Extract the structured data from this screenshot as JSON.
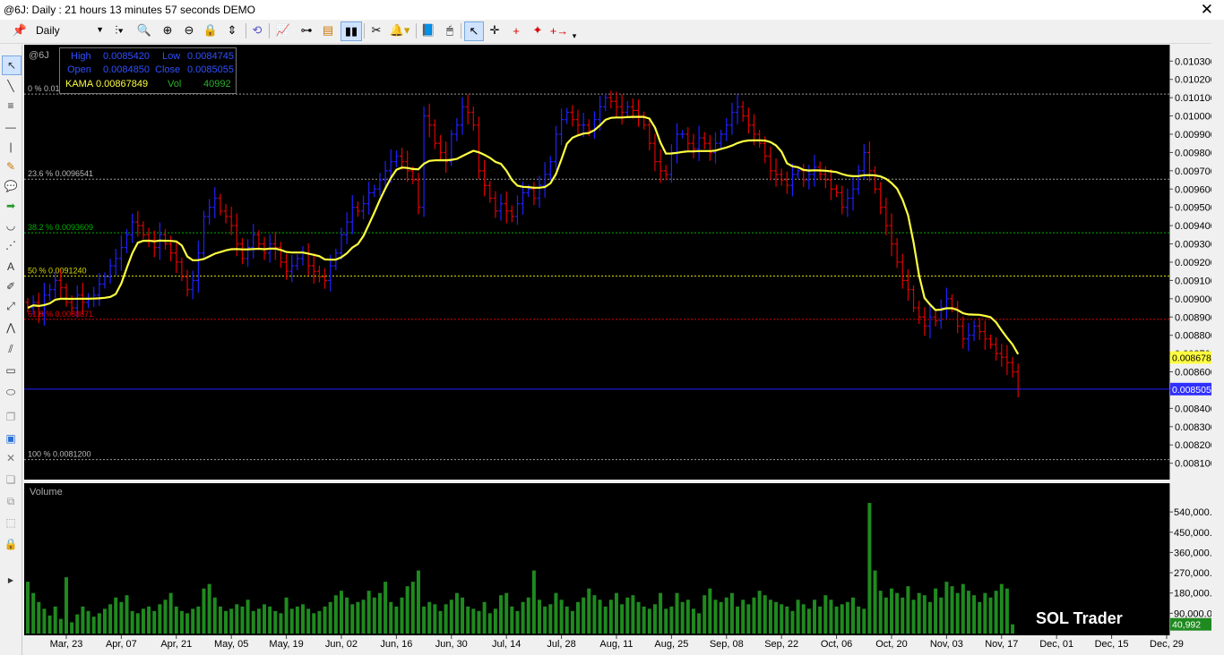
{
  "window": {
    "title": "@6J: Daily : 21 hours 13 minutes 57 seconds DEMO",
    "close": "✕"
  },
  "toolbar": {
    "interval": "Daily"
  },
  "info": {
    "high_label": "High",
    "high": "0.0085420",
    "low_label": "Low",
    "low": "0.0084745",
    "open_label": "Open",
    "open": "0.0084850",
    "close_label": "Close",
    "close": "0.0085055",
    "kama_label": "KAMA",
    "kama": "0.00867849",
    "vol_label": "Vol",
    "vol": "40992"
  },
  "symbol": "@6J",
  "volume_panel": {
    "title": "Volume",
    "last_value": "40,992"
  },
  "watermark": "SOL Trader",
  "chart_data": {
    "type": "ohlc",
    "y_ticks": [
      0.0081,
      0.0082,
      0.0083,
      0.0084,
      0.0085,
      0.0086,
      0.0087,
      0.0088,
      0.0089,
      0.009,
      0.0091,
      0.0092,
      0.0093,
      0.0094,
      0.0095,
      0.0096,
      0.0097,
      0.0098,
      0.0099,
      0.01,
      0.0101,
      0.0102,
      0.0103
    ],
    "y_tick_labels": [
      "0.0081000",
      "0.0082000",
      "0.0083000",
      "0.0084000",
      "0.0085000",
      "0.0086000",
      "0.0087000",
      "0.0088000",
      "0.0089000",
      "0.0090000",
      "0.0091000",
      "0.0092000",
      "0.0093000",
      "0.0094000",
      "0.0095000",
      "0.0096000",
      "0.0097000",
      "0.0098000",
      "0.0099000",
      "0.0100000",
      "0.0101000",
      "0.0102000",
      "0.0103000"
    ],
    "ylim": [
      0.00802,
      0.01037
    ],
    "x_labels": [
      "Mar, 23",
      "Apr, 07",
      "Apr, 21",
      "May, 05",
      "May, 19",
      "Jun, 02",
      "Jun, 16",
      "Jun, 30",
      "Jul, 14",
      "Jul, 28",
      "Aug, 11",
      "Aug, 25",
      "Sep, 08",
      "Sep, 22",
      "Oct, 06",
      "Oct, 20",
      "Nov, 03",
      "Nov, 17",
      "Dec, 01",
      "Dec, 15",
      "Dec, 29"
    ],
    "x_label_index": [
      7,
      17,
      27,
      37,
      47,
      57,
      67,
      77,
      87,
      97,
      107,
      117,
      127,
      137,
      147,
      157,
      167,
      177,
      187,
      197,
      207
    ],
    "fib_levels": [
      {
        "label": "0 % 0.0101",
        "value": 0.01012,
        "color": "#9a9a9a"
      },
      {
        "label": "23.6 % 0.0096541",
        "value": 0.0096541,
        "color": "#9a9a9a"
      },
      {
        "label": "38.2 % 0.0093609",
        "value": 0.0093609,
        "color": "#00b000"
      },
      {
        "label": "50 % 0.0091240",
        "value": 0.009124,
        "color": "#d8d800"
      },
      {
        "label": "61.8 % 0.0088871",
        "value": 0.0088871,
        "color": "#e00000"
      },
      {
        "label": "100 % 0.0081200",
        "value": 0.00812,
        "color": "#9a9a9a"
      }
    ],
    "price_line": {
      "value": 0.0085055,
      "label": "0.0085055",
      "color": "#2020ff"
    },
    "kama_badge": {
      "value": 0.00867849,
      "label": "0.0086785"
    },
    "kama_color": "#ffff40",
    "up_color": "#2020ff",
    "down_color": "#e00000",
    "closes": [
      0.00895,
      0.00898,
      0.00892,
      0.00902,
      0.00905,
      0.0091,
      0.00906,
      0.00898,
      0.00895,
      0.00902,
      0.00898,
      0.009,
      0.00902,
      0.00908,
      0.00912,
      0.00918,
      0.00922,
      0.00928,
      0.00935,
      0.00942,
      0.0094,
      0.00935,
      0.00932,
      0.00928,
      0.00935,
      0.0093,
      0.00925,
      0.0092,
      0.00912,
      0.00905,
      0.0091,
      0.00925,
      0.00945,
      0.0095,
      0.00955,
      0.00948,
      0.00945,
      0.0094,
      0.0093,
      0.00922,
      0.00928,
      0.00935,
      0.0093,
      0.00925,
      0.0093,
      0.00928,
      0.0092,
      0.00915,
      0.00918,
      0.00922,
      0.00925,
      0.00918,
      0.00915,
      0.00912,
      0.0091,
      0.00918,
      0.00925,
      0.00935,
      0.00942,
      0.0095,
      0.00948,
      0.00952,
      0.00958,
      0.0096,
      0.00965,
      0.0097,
      0.00975,
      0.00978,
      0.00975,
      0.0097,
      0.00965,
      0.0095,
      0.01,
      0.00995,
      0.00985,
      0.0098,
      0.00975,
      0.0099,
      0.00995,
      0.01005,
      0.01002,
      0.00995,
      0.0097,
      0.00962,
      0.00955,
      0.00948,
      0.00952,
      0.00948,
      0.00945,
      0.00952,
      0.00958,
      0.0096,
      0.00955,
      0.00962,
      0.00968,
      0.00975,
      0.0099,
      0.00998,
      0.01002,
      0.00998,
      0.00995,
      0.00995,
      0.00992,
      0.00998,
      0.01005,
      0.0101,
      0.01008,
      0.01005,
      0.01002,
      0.01005,
      0.01003,
      0.01,
      0.00995,
      0.00985,
      0.00975,
      0.0097,
      0.00968,
      0.0098,
      0.0099,
      0.0099,
      0.00985,
      0.00982,
      0.00988,
      0.00985,
      0.0098,
      0.00985,
      0.0099,
      0.00995,
      0.01002,
      0.01005,
      0.01,
      0.00995,
      0.0099,
      0.00985,
      0.00978,
      0.0097,
      0.00968,
      0.00965,
      0.00962,
      0.00968,
      0.0097,
      0.00965,
      0.00968,
      0.00972,
      0.00968,
      0.00965,
      0.0096,
      0.00958,
      0.0095,
      0.00955,
      0.0096,
      0.0097,
      0.0098,
      0.0097,
      0.0096,
      0.0095,
      0.0094,
      0.0093,
      0.0092,
      0.0091,
      0.00905,
      0.00895,
      0.0089,
      0.00885,
      0.0089,
      0.00888,
      0.00895,
      0.009,
      0.00895,
      0.00885,
      0.00878,
      0.0088,
      0.00885,
      0.00882,
      0.00878,
      0.00875,
      0.0087,
      0.00868,
      0.00865,
      0.0086,
      0.0085055
    ],
    "volumes": [
      230000,
      180000,
      140000,
      110000,
      80000,
      120000,
      65000,
      250000,
      50000,
      85000,
      120000,
      100000,
      75000,
      90000,
      110000,
      130000,
      160000,
      140000,
      170000,
      100000,
      90000,
      110000,
      120000,
      100000,
      130000,
      150000,
      180000,
      120000,
      100000,
      90000,
      110000,
      120000,
      200000,
      220000,
      160000,
      120000,
      100000,
      110000,
      130000,
      120000,
      150000,
      100000,
      110000,
      130000,
      120000,
      100000,
      90000,
      160000,
      110000,
      120000,
      130000,
      110000,
      90000,
      100000,
      120000,
      140000,
      170000,
      190000,
      160000,
      130000,
      140000,
      150000,
      190000,
      160000,
      180000,
      230000,
      140000,
      120000,
      160000,
      210000,
      230000,
      280000,
      120000,
      140000,
      130000,
      100000,
      130000,
      150000,
      180000,
      160000,
      120000,
      110000,
      100000,
      140000,
      90000,
      110000,
      170000,
      180000,
      120000,
      100000,
      140000,
      160000,
      280000,
      150000,
      120000,
      130000,
      180000,
      150000,
      120000,
      100000,
      140000,
      160000,
      200000,
      170000,
      150000,
      120000,
      150000,
      180000,
      130000,
      160000,
      170000,
      140000,
      120000,
      110000,
      130000,
      180000,
      110000,
      120000,
      180000,
      140000,
      150000,
      110000,
      90000,
      170000,
      200000,
      150000,
      140000,
      160000,
      180000,
      120000,
      150000,
      130000,
      160000,
      190000,
      170000,
      150000,
      140000,
      130000,
      120000,
      100000,
      150000,
      130000,
      110000,
      150000,
      120000,
      170000,
      150000,
      120000,
      130000,
      140000,
      160000,
      120000,
      110000,
      580000,
      280000,
      190000,
      160000,
      200000,
      180000,
      160000,
      210000,
      150000,
      180000,
      170000,
      140000,
      200000,
      160000,
      230000,
      210000,
      180000,
      220000,
      190000,
      170000,
      140000,
      180000,
      160000,
      190000,
      220000,
      200000,
      40992
    ],
    "vol_y_ticks": [
      90000,
      180000,
      270000,
      360000,
      450000,
      540000
    ],
    "vol_y_tick_labels": [
      "90,000.0",
      "180,000.0",
      "270,000.0",
      "360,000.0",
      "450,000.0",
      "540,000.0"
    ],
    "vol_ylim": [
      0,
      620000
    ],
    "vol_color": "#1f8a1f"
  }
}
